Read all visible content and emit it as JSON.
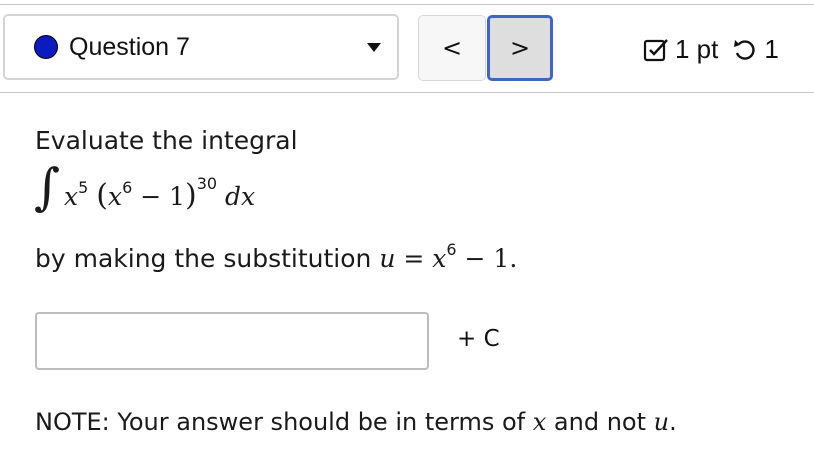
{
  "header": {
    "question_label": "Question 7",
    "prev_label": "<",
    "next_label": ">",
    "points": "1 pt",
    "attempts": "1"
  },
  "problem": {
    "prompt": "Evaluate the integral",
    "integrand": {
      "x": "x",
      "power1": "5",
      "open": "(",
      "inner_power": "6",
      "minus_one": " − 1",
      "close": ")",
      "outer_power": "30",
      "dx": "dx"
    },
    "substitution_text": "by making the substitution ",
    "substitution_math": {
      "lhs": "u",
      "eq": " = ",
      "x": "x",
      "power": "6",
      "rest": " − 1."
    },
    "answer_value": "",
    "constant_label": "+ C",
    "note_text": "NOTE: Your answer should be in terms of ",
    "note_x": "x",
    "note_and_not": " and not ",
    "note_u": "u",
    "note_end": "."
  },
  "colors": {
    "dot": "#0b1bbf",
    "next_border": "#3f66c5"
  }
}
